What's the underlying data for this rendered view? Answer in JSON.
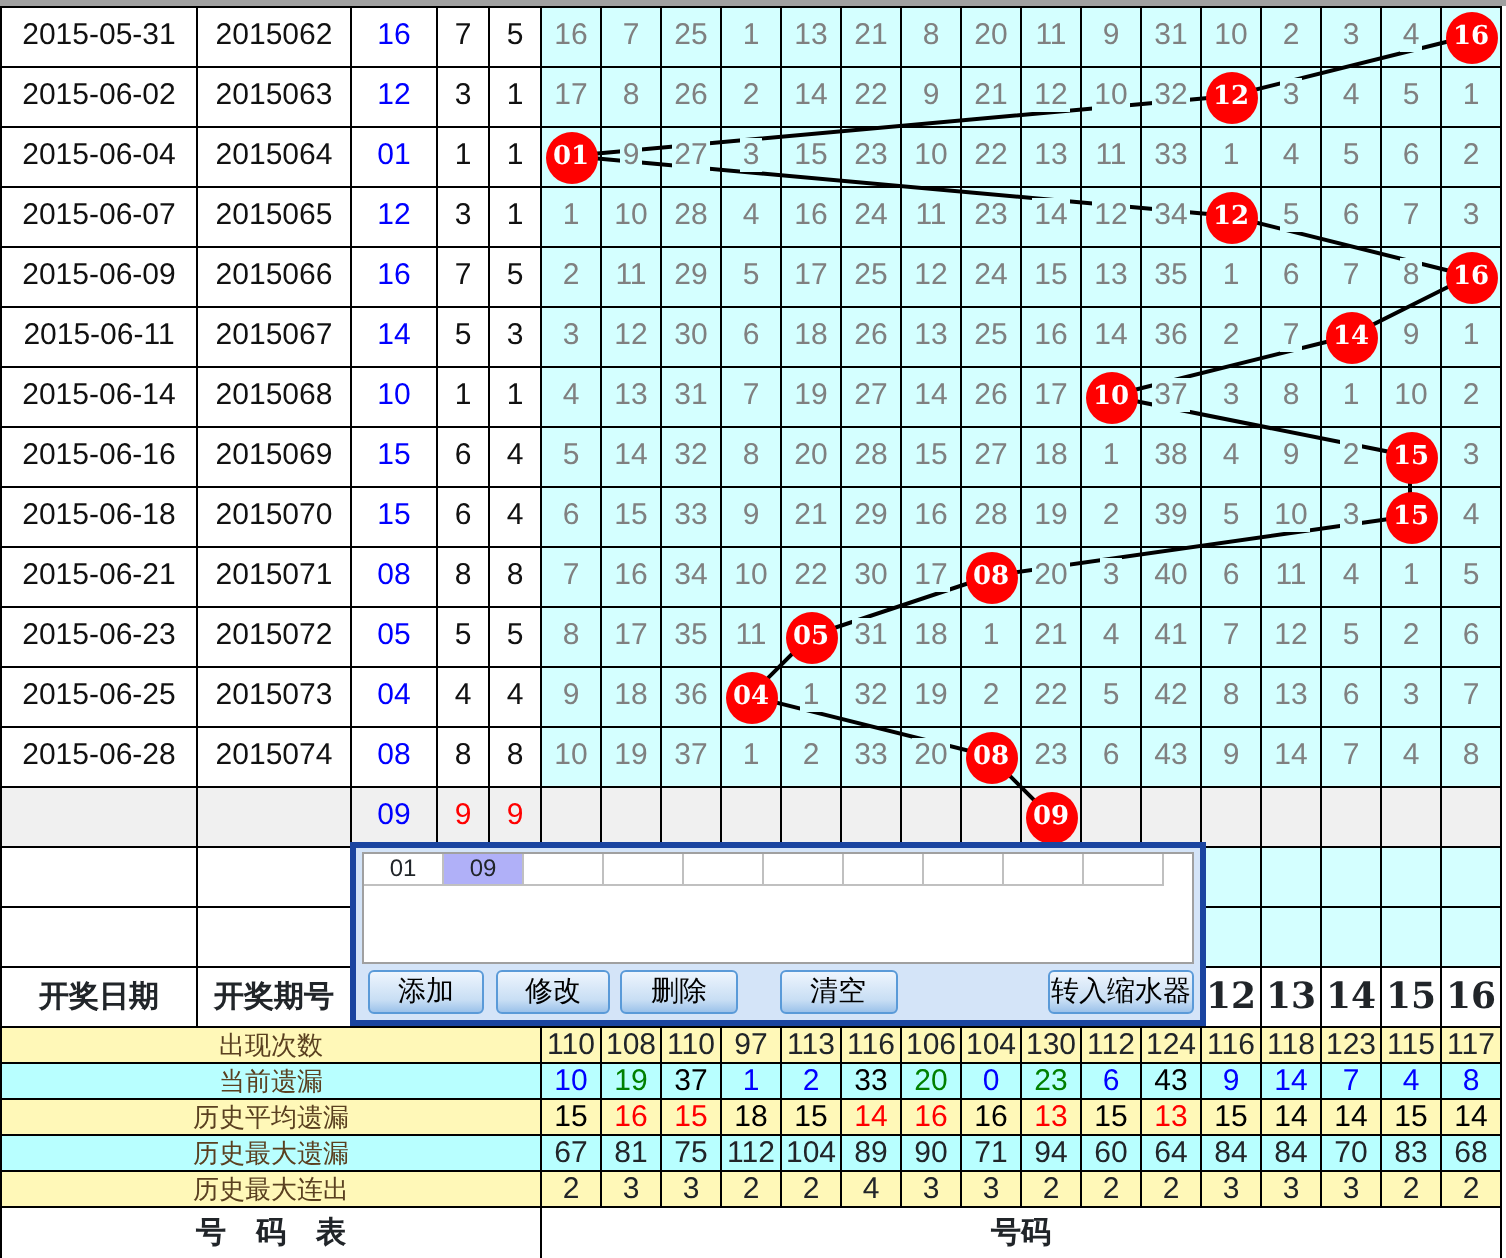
{
  "draws": [
    {
      "date": "2015-05-31",
      "issue": "2015062",
      "number": "16",
      "col_4": "7",
      "col_5": "5",
      "ball": "16",
      "cells": [
        "16",
        "7",
        "25",
        "1",
        "13",
        "21",
        "8",
        "20",
        "11",
        "9",
        "31",
        "10",
        "2",
        "3",
        "4"
      ]
    },
    {
      "date": "2015-06-02",
      "issue": "2015063",
      "number": "12",
      "col_4": "3",
      "col_5": "1",
      "ball": "12",
      "cells": [
        "17",
        "8",
        "26",
        "2",
        "14",
        "22",
        "9",
        "21",
        "12",
        "10",
        "32",
        "3",
        "4",
        "5",
        "1"
      ]
    },
    {
      "date": "2015-06-04",
      "issue": "2015064",
      "number": "01",
      "col_4": "1",
      "col_5": "1",
      "ball": "01",
      "cells": [
        "9",
        "27",
        "3",
        "15",
        "23",
        "10",
        "22",
        "13",
        "11",
        "33",
        "1",
        "4",
        "5",
        "6",
        "2"
      ]
    },
    {
      "date": "2015-06-07",
      "issue": "2015065",
      "number": "12",
      "col_4": "3",
      "col_5": "1",
      "ball": "12",
      "cells": [
        "1",
        "10",
        "28",
        "4",
        "16",
        "24",
        "11",
        "23",
        "14",
        "12",
        "34",
        "5",
        "6",
        "7",
        "3"
      ]
    },
    {
      "date": "2015-06-09",
      "issue": "2015066",
      "number": "16",
      "col_4": "7",
      "col_5": "5",
      "ball": "16",
      "cells": [
        "2",
        "11",
        "29",
        "5",
        "17",
        "25",
        "12",
        "24",
        "15",
        "13",
        "35",
        "1",
        "6",
        "7",
        "8"
      ]
    },
    {
      "date": "2015-06-11",
      "issue": "2015067",
      "number": "14",
      "col_4": "5",
      "col_5": "3",
      "ball": "14",
      "cells": [
        "3",
        "12",
        "30",
        "6",
        "18",
        "26",
        "13",
        "25",
        "16",
        "14",
        "36",
        "2",
        "7",
        "9",
        "1"
      ]
    },
    {
      "date": "2015-06-14",
      "issue": "2015068",
      "number": "10",
      "col_4": "1",
      "col_5": "1",
      "ball": "10",
      "cells": [
        "4",
        "13",
        "31",
        "7",
        "19",
        "27",
        "14",
        "26",
        "17",
        "37",
        "3",
        "8",
        "1",
        "10",
        "2"
      ]
    },
    {
      "date": "2015-06-16",
      "issue": "2015069",
      "number": "15",
      "col_4": "6",
      "col_5": "4",
      "ball": "15",
      "cells": [
        "5",
        "14",
        "32",
        "8",
        "20",
        "28",
        "15",
        "27",
        "18",
        "1",
        "38",
        "4",
        "9",
        "2",
        "3"
      ]
    },
    {
      "date": "2015-06-18",
      "issue": "2015070",
      "number": "15",
      "col_4": "6",
      "col_5": "4",
      "ball": "15",
      "cells": [
        "6",
        "15",
        "33",
        "9",
        "21",
        "29",
        "16",
        "28",
        "19",
        "2",
        "39",
        "5",
        "10",
        "3",
        "4"
      ]
    },
    {
      "date": "2015-06-21",
      "issue": "2015071",
      "number": "08",
      "col_4": "8",
      "col_5": "8",
      "ball": "08",
      "cells": [
        "7",
        "16",
        "34",
        "10",
        "22",
        "30",
        "17",
        "20",
        "3",
        "40",
        "6",
        "11",
        "4",
        "1",
        "5"
      ]
    },
    {
      "date": "2015-06-23",
      "issue": "2015072",
      "number": "05",
      "col_4": "5",
      "col_5": "5",
      "ball": "05",
      "cells": [
        "8",
        "17",
        "35",
        "11",
        "31",
        "18",
        "1",
        "21",
        "4",
        "41",
        "7",
        "12",
        "5",
        "2",
        "6"
      ]
    },
    {
      "date": "2015-06-25",
      "issue": "2015073",
      "number": "04",
      "col_4": "4",
      "col_5": "4",
      "ball": "04",
      "cells": [
        "9",
        "18",
        "36",
        "1",
        "32",
        "19",
        "2",
        "22",
        "5",
        "42",
        "8",
        "13",
        "6",
        "3",
        "7"
      ]
    },
    {
      "date": "2015-06-28",
      "issue": "2015074",
      "number": "08",
      "col_4": "8",
      "col_5": "8",
      "ball": "08",
      "cells": [
        "10",
        "19",
        "37",
        "1",
        "2",
        "33",
        "20",
        "23",
        "6",
        "43",
        "9",
        "14",
        "7",
        "4",
        "8"
      ]
    }
  ],
  "prediction": {
    "number": "09",
    "col_4": "9",
    "col_5": "9",
    "ball": "09"
  },
  "header": {
    "date": "开奖日期",
    "issue": "开奖期号",
    "numbers": [
      "12",
      "13",
      "14",
      "15",
      "16"
    ]
  },
  "stats": [
    {
      "label": "出现次数",
      "values": [
        "110",
        "108",
        "110",
        "97",
        "113",
        "116",
        "106",
        "104",
        "130",
        "112",
        "124",
        "116",
        "118",
        "123",
        "115",
        "117"
      ]
    },
    {
      "label": "当前遗漏",
      "values": [
        {
          "text": "10",
          "color": "#0000ff"
        },
        {
          "text": "19",
          "color": "#008000"
        },
        {
          "text": "37",
          "color": "#000000"
        },
        {
          "text": "1",
          "color": "#0000ff"
        },
        {
          "text": "2",
          "color": "#0000ff"
        },
        {
          "text": "33",
          "color": "#000000"
        },
        {
          "text": "20",
          "color": "#008000"
        },
        {
          "text": "0",
          "color": "#0000ff"
        },
        {
          "text": "23",
          "color": "#008000"
        },
        {
          "text": "6",
          "color": "#0000ff"
        },
        {
          "text": "43",
          "color": "#000000"
        },
        {
          "text": "9",
          "color": "#0000ff"
        },
        {
          "text": "14",
          "color": "#0000ff"
        },
        {
          "text": "7",
          "color": "#0000ff"
        },
        {
          "text": "4",
          "color": "#0000ff"
        },
        {
          "text": "8",
          "color": "#0000ff"
        }
      ]
    },
    {
      "label": "历史平均遗漏",
      "values": [
        {
          "text": "15",
          "color": "#000000"
        },
        {
          "text": "16",
          "color": "#ff0000"
        },
        {
          "text": "15",
          "color": "#ff0000"
        },
        {
          "text": "18",
          "color": "#000000"
        },
        {
          "text": "15",
          "color": "#000000"
        },
        {
          "text": "14",
          "color": "#ff0000"
        },
        {
          "text": "16",
          "color": "#ff0000"
        },
        {
          "text": "16",
          "color": "#000000"
        },
        {
          "text": "13",
          "color": "#ff0000"
        },
        {
          "text": "15",
          "color": "#000000"
        },
        {
          "text": "13",
          "color": "#ff0000"
        },
        {
          "text": "15",
          "color": "#000000"
        },
        {
          "text": "14",
          "color": "#000000"
        },
        {
          "text": "14",
          "color": "#000000"
        },
        {
          "text": "15",
          "color": "#000000"
        },
        {
          "text": "14",
          "color": "#000000"
        }
      ]
    },
    {
      "label": "历史最大遗漏",
      "values": [
        "67",
        "81",
        "75",
        "112",
        "104",
        "89",
        "90",
        "71",
        "94",
        "60",
        "64",
        "84",
        "84",
        "70",
        "83",
        "68"
      ]
    },
    {
      "label": "历史最大连出",
      "values": [
        "2",
        "3",
        "3",
        "2",
        "2",
        "4",
        "3",
        "3",
        "2",
        "2",
        "2",
        "3",
        "3",
        "3",
        "2",
        "2"
      ]
    }
  ],
  "footer": {
    "left": "号　码　表",
    "right": "号码"
  },
  "dialog": {
    "items": [
      {
        "text": "01",
        "selected": false
      },
      {
        "text": "09",
        "selected": true
      }
    ],
    "buttons": [
      "添加",
      "修改",
      "删除",
      "清空",
      "转入缩水器"
    ]
  }
}
